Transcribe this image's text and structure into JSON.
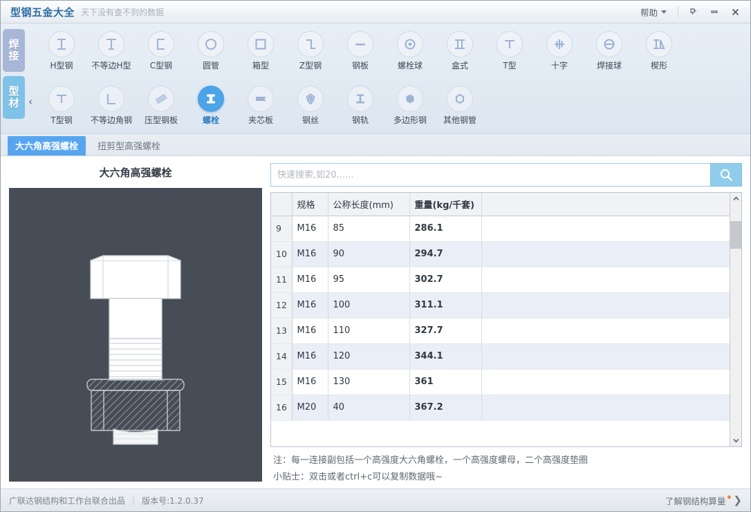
{
  "titlebar": {
    "title": "型钢五金大全",
    "subtitle": "天下没有查不到的数据",
    "help_label": "帮助",
    "pin_icon": "pin-icon",
    "minimize_icon": "minimize-icon",
    "close_icon": "close-icon"
  },
  "ribbon": {
    "categories": [
      {
        "label": "焊接",
        "active": false
      },
      {
        "label": "型材",
        "active": true
      }
    ],
    "collapse_arrow": "‹",
    "row1": [
      {
        "label": "H型钢",
        "icon": "h-beam-icon"
      },
      {
        "label": "不等边H型",
        "icon": "unequal-h-beam-icon"
      },
      {
        "label": "C型钢",
        "icon": "c-channel-icon"
      },
      {
        "label": "圆管",
        "icon": "round-pipe-icon"
      },
      {
        "label": "箱型",
        "icon": "box-section-icon"
      },
      {
        "label": "Z型钢",
        "icon": "z-section-icon"
      },
      {
        "label": "钢板",
        "icon": "steel-plate-icon"
      },
      {
        "label": "螺栓球",
        "icon": "bolt-ball-icon"
      },
      {
        "label": "盒式",
        "icon": "box-type-icon"
      },
      {
        "label": "T型",
        "icon": "t-section-icon"
      },
      {
        "label": "十字",
        "icon": "cross-section-icon"
      },
      {
        "label": "焊接球",
        "icon": "welded-ball-icon"
      },
      {
        "label": "楔形",
        "icon": "wedge-icon"
      }
    ],
    "row2": [
      {
        "label": "T型钢",
        "icon": "t-beam-icon"
      },
      {
        "label": "不等边角钢",
        "icon": "unequal-angle-icon"
      },
      {
        "label": "压型钢板",
        "icon": "corrugated-plate-icon"
      },
      {
        "label": "螺栓",
        "icon": "bolt-icon",
        "active": true
      },
      {
        "label": "夹芯板",
        "icon": "sandwich-panel-icon"
      },
      {
        "label": "钢丝",
        "icon": "steel-wire-icon"
      },
      {
        "label": "钢轨",
        "icon": "rail-icon"
      },
      {
        "label": "多边形钢",
        "icon": "polygon-steel-icon"
      },
      {
        "label": "其他钢管",
        "icon": "other-pipe-icon"
      }
    ]
  },
  "subtabs": [
    {
      "label": "大六角高强螺栓",
      "active": true
    },
    {
      "label": "扭剪型高强螺栓",
      "active": false
    }
  ],
  "left": {
    "title": "大六角高强螺栓",
    "image_name": "hex-bolt-diagram",
    "image_bg": "#474d57"
  },
  "search": {
    "value": "",
    "placeholder": "快速搜索,如20......",
    "button_icon": "search-icon"
  },
  "table": {
    "columns": [
      "",
      "规格",
      "公称长度(mm)",
      "重量(kg/千套)",
      ""
    ],
    "rows": [
      {
        "idx": "9",
        "spec": "M16",
        "length": "85",
        "weight": "286.1"
      },
      {
        "idx": "10",
        "spec": "M16",
        "length": "90",
        "weight": "294.7"
      },
      {
        "idx": "11",
        "spec": "M16",
        "length": "95",
        "weight": "302.7"
      },
      {
        "idx": "12",
        "spec": "M16",
        "length": "100",
        "weight": "311.1"
      },
      {
        "idx": "13",
        "spec": "M16",
        "length": "110",
        "weight": "327.7"
      },
      {
        "idx": "14",
        "spec": "M16",
        "length": "120",
        "weight": "344.1"
      },
      {
        "idx": "15",
        "spec": "M16",
        "length": "130",
        "weight": "361"
      },
      {
        "idx": "16",
        "spec": "M20",
        "length": "40",
        "weight": "367.2"
      }
    ]
  },
  "notes": {
    "line1": "注：每一连接副包括一个高强度大六角螺栓，一个高强度螺母，二个高强度垫圈",
    "line2": "小贴士：双击或者ctrl+c可以复制数据哦~"
  },
  "statusbar": {
    "company": "广联达钢结构和工作台联合出品",
    "separator": "|",
    "version": "版本号:1.2.0.37",
    "promo": "了解钢结构算量",
    "promo_chevron": "❯"
  },
  "colors": {
    "accent": "#4ba3e8",
    "tab_active": "#57a5f0",
    "title": "#2e6da4",
    "image_bg": "#474d57",
    "promo_dot": "#f08a24"
  }
}
